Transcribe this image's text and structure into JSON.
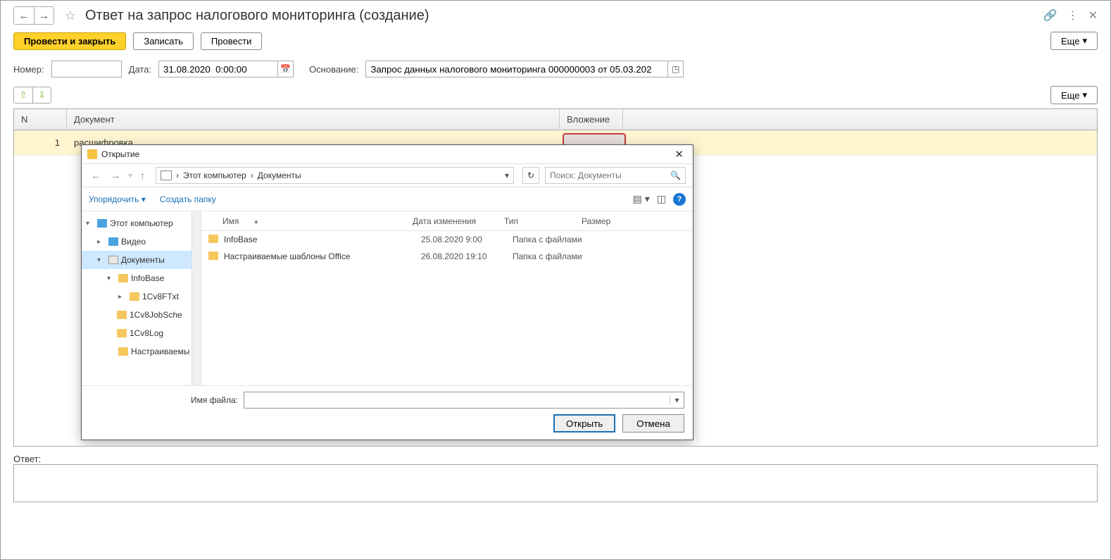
{
  "header": {
    "title": "Ответ на запрос налогового мониторинга (создание)"
  },
  "toolbar": {
    "post_close": "Провести и закрыть",
    "save": "Записать",
    "post": "Провести",
    "more": "Еще"
  },
  "fields": {
    "number_label": "Номер:",
    "number_value": "",
    "date_label": "Дата:",
    "date_value": "31.08.2020  0:00:00",
    "basis_label": "Основание:",
    "basis_value": "Запрос данных налогового мониторинга 000000003 от 05.03.202"
  },
  "table": {
    "col_n": "N",
    "col_doc": "Документ",
    "col_att": "Вложение",
    "rows": [
      {
        "n": "1",
        "doc": "расшифровка"
      }
    ]
  },
  "toolbar2_more": "Еще",
  "dialog": {
    "title": "Открытие",
    "breadcrumb_1": "Этот компьютер",
    "breadcrumb_2": "Документы",
    "search_placeholder": "Поиск: Документы",
    "organize": "Упорядочить",
    "new_folder": "Создать папку",
    "tree": {
      "this_pc": "Этот компьютер",
      "video": "Видео",
      "documents": "Документы",
      "infobase": "InfoBase",
      "cv8ftxt": "1Cv8FTxt",
      "cv8jobsch": "1Cv8JobSche",
      "cv8log": "1Cv8Log",
      "custom_tpl": "Настраиваемы"
    },
    "files_header": {
      "name": "Имя",
      "date": "Дата изменения",
      "type": "Тип",
      "size": "Размер"
    },
    "files": [
      {
        "name": "InfoBase",
        "date": "25.08.2020 9:00",
        "type": "Папка с файлами"
      },
      {
        "name": "Настраиваемые шаблоны Office",
        "date": "26.08.2020 19:10",
        "type": "Папка с файлами"
      }
    ],
    "filename_label": "Имя файла:",
    "open_btn": "Открыть",
    "cancel_btn": "Отмена"
  },
  "answer": {
    "label": "Ответ:"
  }
}
